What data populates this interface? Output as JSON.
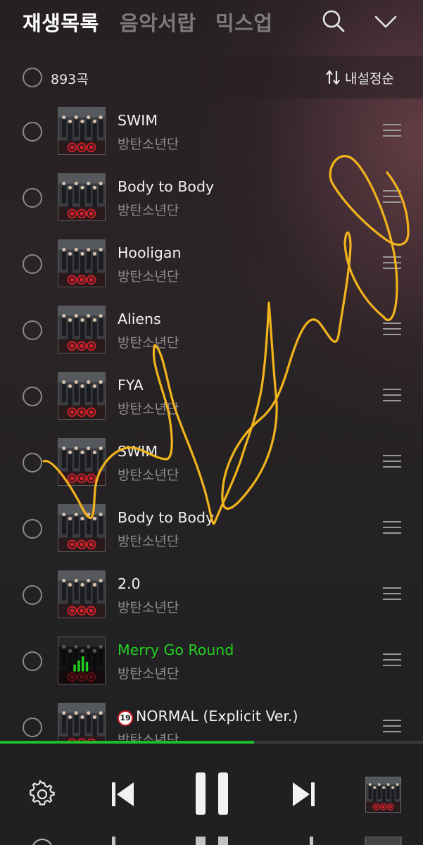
{
  "header": {
    "tabs": [
      {
        "label": "재생목록",
        "active": true
      },
      {
        "label": "음악서랍",
        "active": false
      },
      {
        "label": "믹스업",
        "active": false
      }
    ],
    "icons": {
      "search": "search-icon",
      "collapse": "chevron-down-icon"
    }
  },
  "subbar": {
    "count": "893곡",
    "sort_label": "내설정순",
    "sort_icon": "sort-arrows-icon"
  },
  "songs": [
    {
      "title": "SWIM",
      "artist": "방탄소년단"
    },
    {
      "title": "Body to Body",
      "artist": "방탄소년단"
    },
    {
      "title": "Hooligan",
      "artist": "방탄소년단"
    },
    {
      "title": "Aliens",
      "artist": "방탄소년단"
    },
    {
      "title": "FYA",
      "artist": "방탄소년단"
    },
    {
      "title": "SWIM",
      "artist": "방탄소년단"
    },
    {
      "title": "Body to Body",
      "artist": "방탄소년단"
    },
    {
      "title": "2.0",
      "artist": "방탄소년단"
    },
    {
      "title": "Merry Go Round",
      "artist": "방탄소년단",
      "playing": true
    },
    {
      "title": "NORMAL (Explicit Ver.)",
      "artist": "방탄소년단",
      "badge": "19"
    }
  ],
  "player": {
    "progress": 0.6,
    "icons": [
      "settings-icon",
      "skip-previous-icon",
      "pause-icon",
      "skip-next-icon"
    ]
  },
  "colors": {
    "accent_green": "#22d11f",
    "scribble": "#f2b31c",
    "background": "#1d1d1f"
  }
}
